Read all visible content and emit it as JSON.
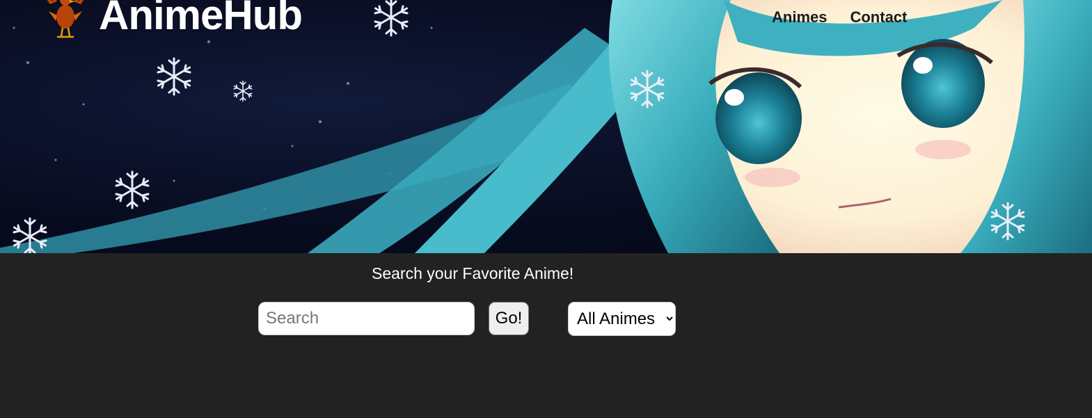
{
  "brand": {
    "title": "AnimeHub",
    "logo_icon": "rooster-icon"
  },
  "nav": {
    "items": [
      {
        "label": "Animes"
      },
      {
        "label": "Contact"
      }
    ]
  },
  "hero": {
    "image": "anime-girl-snowflakes-banner",
    "accent_colors": [
      "#0b1230",
      "#3fb6c4",
      "#fff7e4"
    ]
  },
  "search": {
    "heading": "Search your Favorite Anime!",
    "placeholder": "Search",
    "value": "",
    "button_label": "Go!",
    "filter": {
      "selected": "All Animes"
    }
  },
  "colors": {
    "page_bg": "#222222",
    "heading_text": "#ffffff",
    "nav_text": "#1c1c1c"
  }
}
